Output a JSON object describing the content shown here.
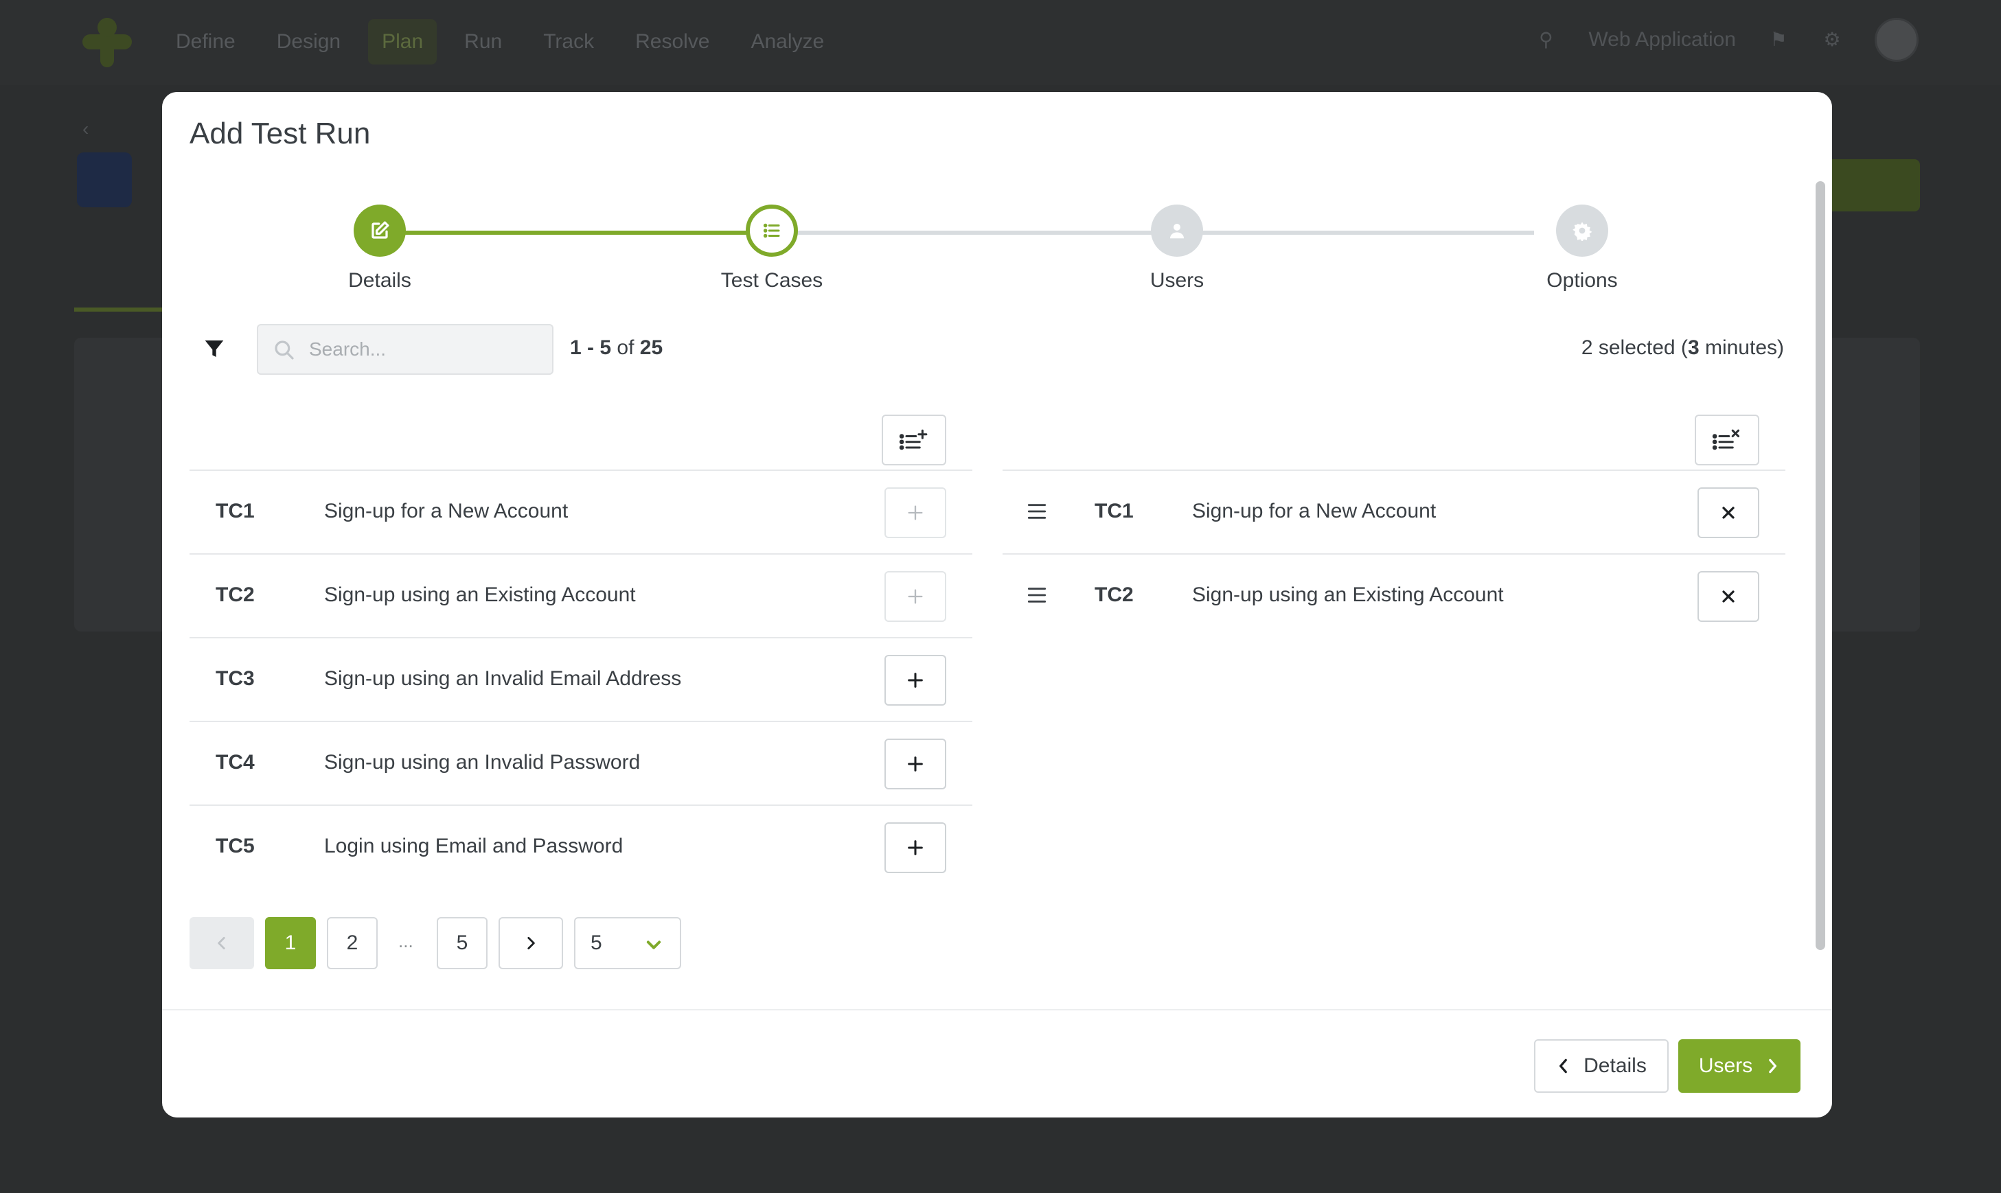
{
  "colors": {
    "accent": "#7faa2a",
    "inactive_step": "#d8dcdf",
    "text": "#3a3f44",
    "overlay_bg": "#2c2e2f"
  },
  "app": {
    "nav": [
      "Define",
      "Design",
      "Plan",
      "Run",
      "Track",
      "Resolve",
      "Analyze"
    ],
    "active_nav": "Plan",
    "project": "Web Application",
    "icons": [
      "search-icon",
      "bell-icon",
      "gear-icon"
    ]
  },
  "modal": {
    "title": "Add Test Run",
    "steps": [
      {
        "label": "Details",
        "state": "done",
        "icon": "edit-icon"
      },
      {
        "label": "Test Cases",
        "state": "current",
        "icon": "list-icon"
      },
      {
        "label": "Users",
        "state": "upcoming",
        "icon": "user-icon"
      },
      {
        "label": "Options",
        "state": "upcoming",
        "icon": "gear-icon"
      }
    ],
    "search": {
      "placeholder": "Search...",
      "value": ""
    },
    "range": {
      "from": "1",
      "to": "5",
      "of_label": "of",
      "total": "25"
    },
    "selection": {
      "count_text": "2 selected (",
      "minutes": "3",
      "minutes_suffix": " minutes)"
    },
    "available": [
      {
        "id": "TC1",
        "title": "Sign-up for a New Account",
        "added": true
      },
      {
        "id": "TC2",
        "title": "Sign-up using an Existing Account",
        "added": true
      },
      {
        "id": "TC3",
        "title": "Sign-up using an Invalid Email Address",
        "added": false
      },
      {
        "id": "TC4",
        "title": "Sign-up using an Invalid Password",
        "added": false
      },
      {
        "id": "TC5",
        "title": "Login using Email and Password",
        "added": false
      }
    ],
    "selected": [
      {
        "id": "TC1",
        "title": "Sign-up for a New Account"
      },
      {
        "id": "TC2",
        "title": "Sign-up using an Existing Account"
      }
    ],
    "pagination": {
      "pages": [
        "1",
        "2",
        "...",
        "5"
      ],
      "current": "1",
      "page_size": "5"
    },
    "footer": {
      "back_label": "Details",
      "next_label": "Users"
    }
  }
}
